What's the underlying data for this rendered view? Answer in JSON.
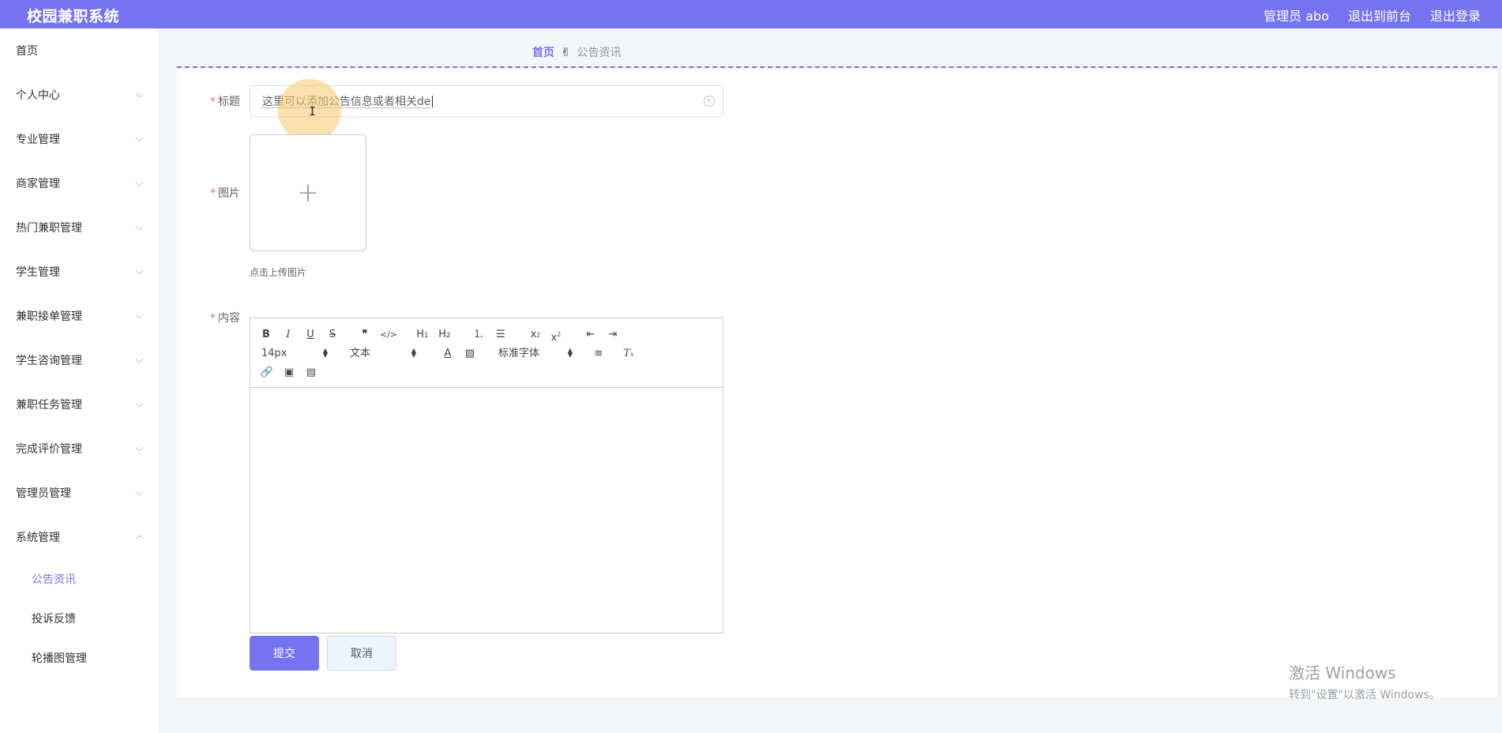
{
  "header": {
    "app_title": "校园兼职系统",
    "user_label": "管理员 abo",
    "to_frontend": "退出到前台",
    "logout": "退出登录"
  },
  "sidebar": {
    "items": [
      {
        "label": "首页",
        "has_arrow": false
      },
      {
        "label": "个人中心",
        "has_arrow": true
      },
      {
        "label": "专业管理",
        "has_arrow": true
      },
      {
        "label": "商家管理",
        "has_arrow": true
      },
      {
        "label": "热门兼职管理",
        "has_arrow": true
      },
      {
        "label": "学生管理",
        "has_arrow": true
      },
      {
        "label": "兼职接单管理",
        "has_arrow": true
      },
      {
        "label": "学生咨询管理",
        "has_arrow": true
      },
      {
        "label": "兼职任务管理",
        "has_arrow": true
      },
      {
        "label": "完成评价管理",
        "has_arrow": true
      },
      {
        "label": "管理员管理",
        "has_arrow": true
      },
      {
        "label": "系统管理",
        "has_arrow": true,
        "expanded": true
      }
    ],
    "subitems": [
      {
        "label": "公告资讯",
        "active": true
      },
      {
        "label": "投诉反馈",
        "active": false
      },
      {
        "label": "轮播图管理",
        "active": false
      }
    ]
  },
  "breadcrumb": {
    "home": "首页",
    "separator_icon": "hand-icon",
    "current": "公告资讯"
  },
  "form": {
    "title_label": "标题",
    "title_value": "这里可以添加公告信息或者相关de",
    "image_label": "图片",
    "upload_tip": "点击上传图片",
    "content_label": "内容",
    "required_mark": "*"
  },
  "editor": {
    "font_size": "14px",
    "header_select": "文本",
    "font_family": "标准字体",
    "toolbar_icons": [
      "bold-icon",
      "italic-icon",
      "underline-icon",
      "strike-icon",
      "blockquote-icon",
      "code-block-icon",
      "h1-icon",
      "h2-icon",
      "ordered-list-icon",
      "bullet-list-icon",
      "subscript-icon",
      "superscript-icon",
      "outdent-icon",
      "indent-icon",
      "font-color-icon",
      "background-color-icon",
      "align-icon",
      "clean-format-icon",
      "link-icon",
      "image-icon",
      "video-icon"
    ],
    "content": ""
  },
  "buttons": {
    "submit": "提交",
    "cancel": "取消"
  },
  "watermark": {
    "line1": "激活 Windows",
    "line2": "转到\"设置\"以激活 Windows。"
  },
  "colors": {
    "accent": "#7673f0",
    "required": "#f56c6c",
    "cancel_bg": "#ecf5ff"
  }
}
